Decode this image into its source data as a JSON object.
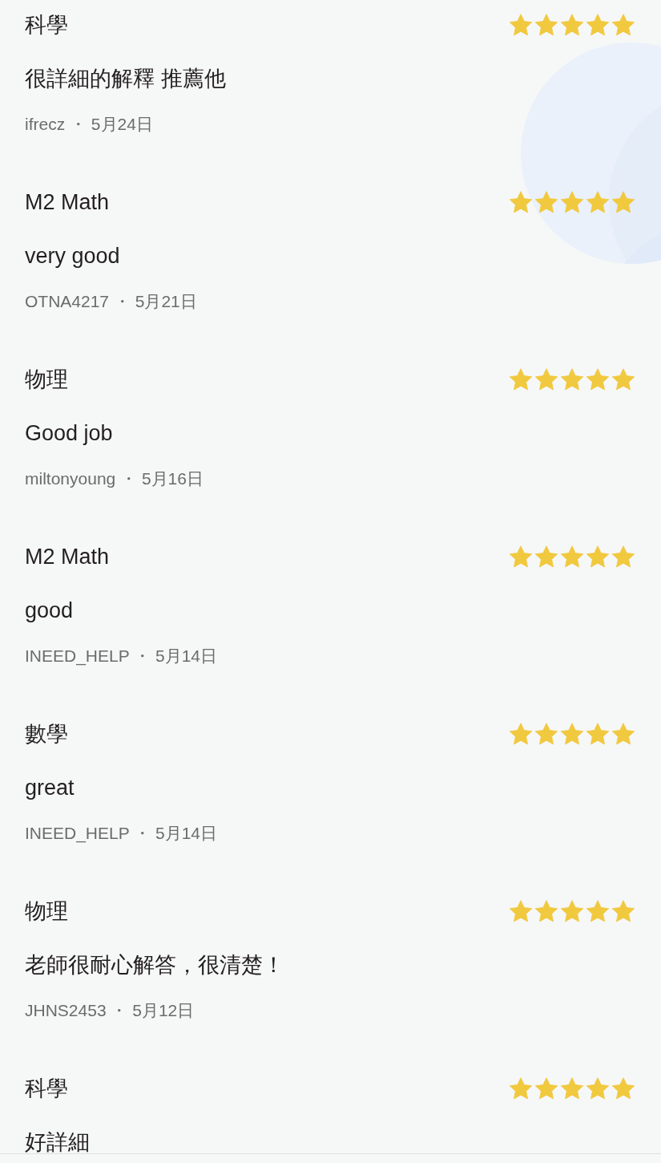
{
  "reviews": [
    {
      "subject": "科學",
      "stars": 5,
      "comment": "很詳細的解釋 推薦他",
      "meta": "ifrecz ・ 5月24日"
    },
    {
      "subject": "M2 Math",
      "stars": 5,
      "comment": "very good",
      "meta": "OTNA4217 ・ 5月21日"
    },
    {
      "subject": "物理",
      "stars": 5,
      "comment": "Good job",
      "meta": "miltonyoung ・ 5月16日"
    },
    {
      "subject": "M2 Math",
      "stars": 5,
      "comment": "good",
      "meta": "INEED_HELP ・ 5月14日"
    },
    {
      "subject": "數學",
      "stars": 5,
      "comment": "great",
      "meta": "INEED_HELP ・ 5月14日"
    },
    {
      "subject": "物理",
      "stars": 5,
      "comment": "老師很耐心解答，很清楚！",
      "meta": "JHNS2453 ・ 5月12日"
    },
    {
      "subject": "科學",
      "stars": 5,
      "comment": "好詳細"
    }
  ]
}
